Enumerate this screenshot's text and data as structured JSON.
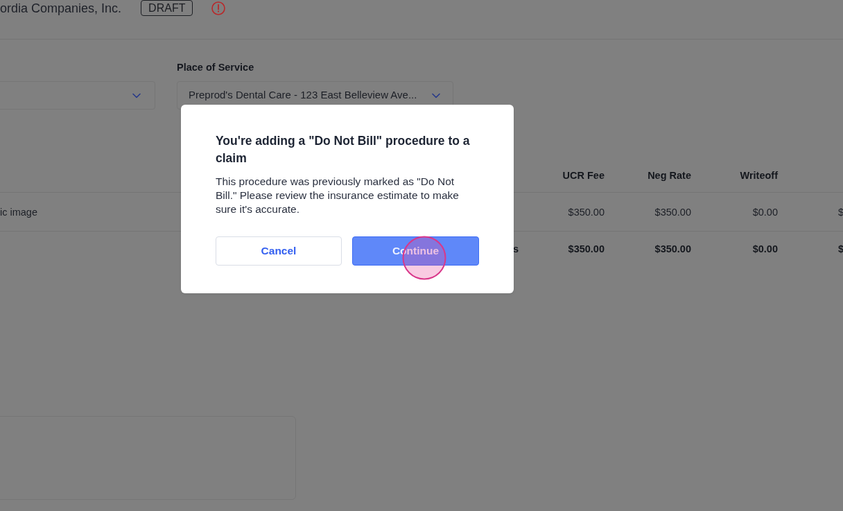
{
  "header": {
    "company": "ordia Companies, Inc.",
    "status_badge": "DRAFT"
  },
  "place_of_service": {
    "label": "Place of Service",
    "value": "Preprod's Dental Care - 123 East Belleview Ave..."
  },
  "table": {
    "headers": {
      "ucr_fee": "UCR Fee",
      "neg_rate": "Neg Rate",
      "writeoff": "Writeoff"
    },
    "rows": [
      {
        "description": "ic image",
        "ucr_fee": "$350.00",
        "neg_rate": "$350.00",
        "writeoff": "$0.00",
        "column_5": "$"
      }
    ],
    "totals": {
      "label": "s",
      "ucr_fee": "$350.00",
      "neg_rate": "$350.00",
      "writeoff": "$0.00",
      "column_5": "$"
    }
  },
  "modal": {
    "title": "You're adding a \"Do Not Bill\" procedure to a claim",
    "message": "This procedure was previously marked as \"Do Not Bill.\" Please review the insurance estimate to make sure it's accurate.",
    "buttons": [
      {
        "label": "Cancel",
        "kind": "secondary"
      },
      {
        "label": "Continue",
        "kind": "primary"
      }
    ]
  }
}
